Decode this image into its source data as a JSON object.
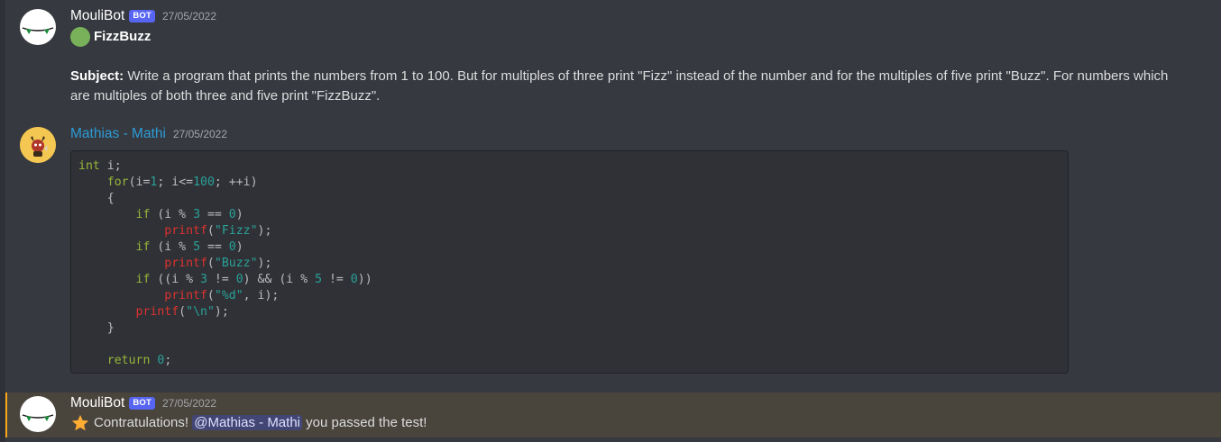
{
  "messages": [
    {
      "author": "MouliBot",
      "badge": "BOT",
      "timestamp": "27/05/2022",
      "title": "FizzBuzz",
      "subject_label": "Subject:",
      "subject_text": " Write a program that prints the numbers from 1 to 100. But for multiples of three print \"Fizz\" instead of the number and for the multiples of five print \"Buzz\". For numbers which are multiples of both three and five print \"FizzBuzz\"."
    },
    {
      "author": "Mathias - Mathi",
      "timestamp": "27/05/2022",
      "code_lines": [
        "int i;",
        "    for(i=1; i<=100; ++i)",
        "    {",
        "        if (i % 3 == 0)",
        "            printf(\"Fizz\");",
        "        if (i % 5 == 0)",
        "            printf(\"Buzz\");",
        "        if ((i % 3 != 0) && (i % 5 != 0))",
        "            printf(\"%d\", i);",
        "        printf(\"\\n\");",
        "    }",
        "",
        "    return 0;"
      ]
    },
    {
      "author": "MouliBot",
      "badge": "BOT",
      "timestamp": "27/05/2022",
      "text_before": "Contratulations! ",
      "mention": "@Mathias - Mathi",
      "text_after": " you passed the test!"
    }
  ],
  "colors": {
    "background": "#36393f",
    "bot_badge": "#5865f2",
    "mention_highlight": "#49443c",
    "mention_bar": "#faa81a",
    "status_green": "#78b159"
  },
  "icons": [
    "moulibot-avatar-icon",
    "mathias-avatar-icon",
    "green-circle-icon",
    "star-icon"
  ]
}
